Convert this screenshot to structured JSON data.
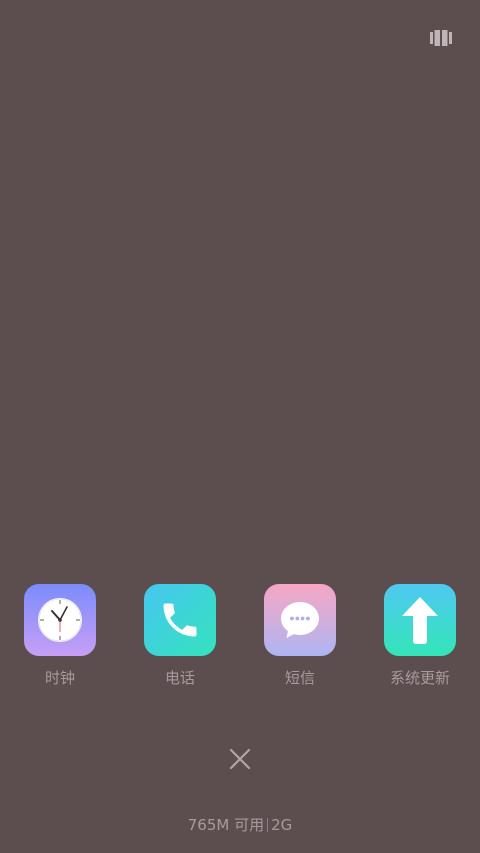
{
  "recents": {
    "layout_toggle_icon": "grid-layout-icon",
    "apps": [
      {
        "label": "时钟",
        "icon": "clock-icon"
      },
      {
        "label": "电话",
        "icon": "phone-icon"
      },
      {
        "label": "短信",
        "icon": "message-icon"
      },
      {
        "label": "系统更新",
        "icon": "arrow-up-icon"
      }
    ],
    "clear_icon": "close-icon",
    "memory": {
      "available": "765M 可用",
      "total": "2G"
    }
  }
}
